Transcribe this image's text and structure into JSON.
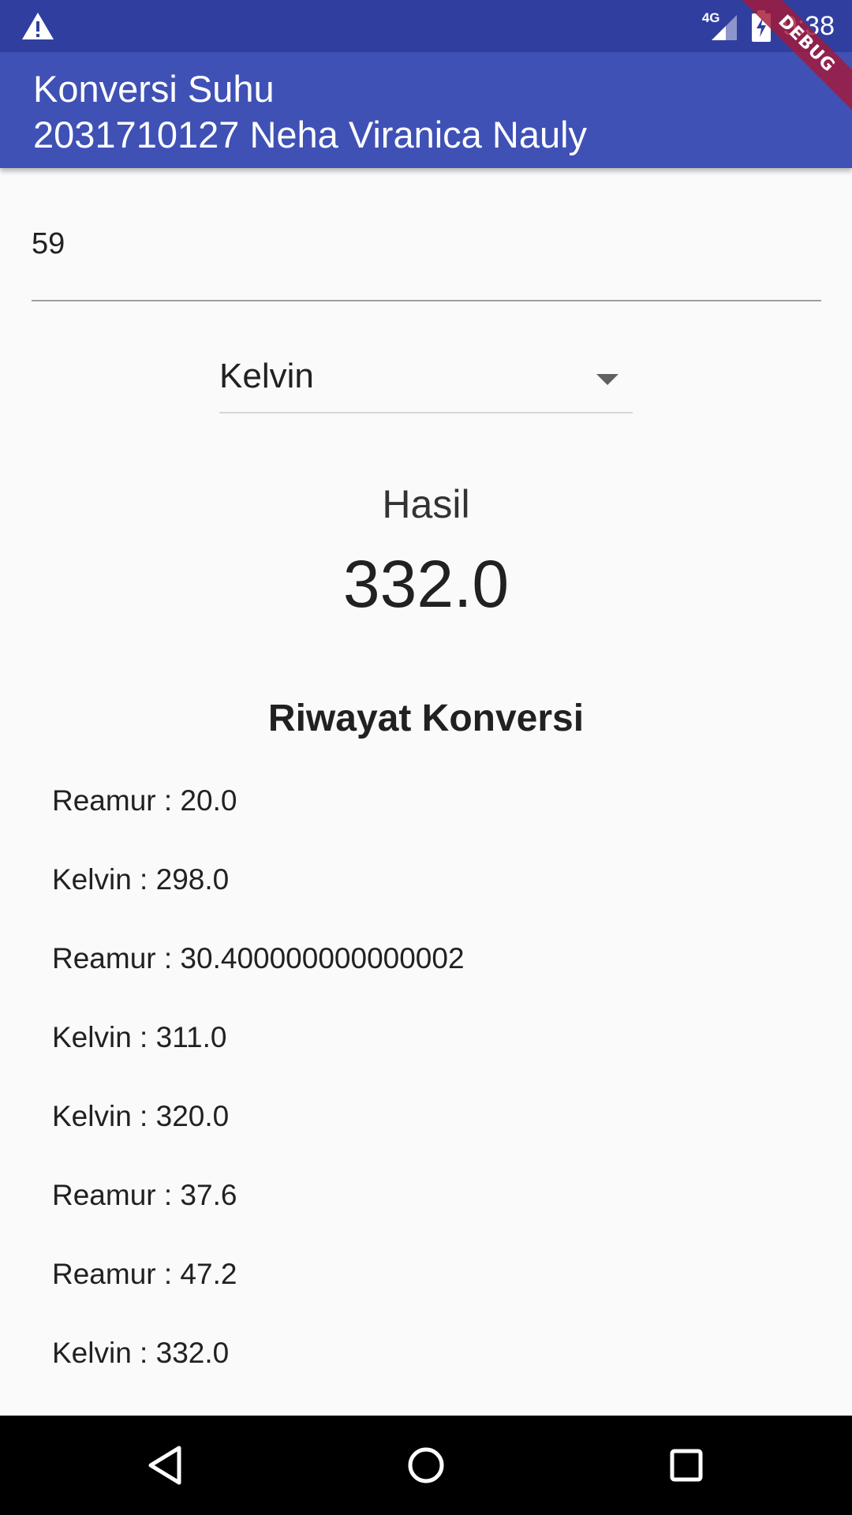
{
  "status_bar": {
    "network_type": "4G",
    "time": "9:38",
    "background_color": "#303f9f",
    "icons": [
      "warning-icon",
      "signal-icon",
      "battery-charging-icon"
    ]
  },
  "debug_banner": {
    "label": "DEBUG",
    "color": "#a51838"
  },
  "app_bar": {
    "title_line1": "Konversi Suhu",
    "title_line2": "2031710127 Neha Viranica Nauly",
    "background_color": "#3f51b5"
  },
  "input": {
    "value": "59"
  },
  "dropdown": {
    "selected": "Kelvin"
  },
  "result": {
    "label": "Hasil",
    "value": "332.0"
  },
  "history": {
    "title": "Riwayat Konversi",
    "items": [
      "Reamur : 20.0",
      "Kelvin : 298.0",
      "Reamur : 30.400000000000002",
      "Kelvin : 311.0",
      "Kelvin : 320.0",
      "Reamur : 37.6",
      "Reamur : 47.2",
      "Kelvin : 332.0"
    ]
  },
  "nav_bar": {
    "buttons": [
      "back-icon",
      "home-icon",
      "recent-apps-icon"
    ]
  }
}
